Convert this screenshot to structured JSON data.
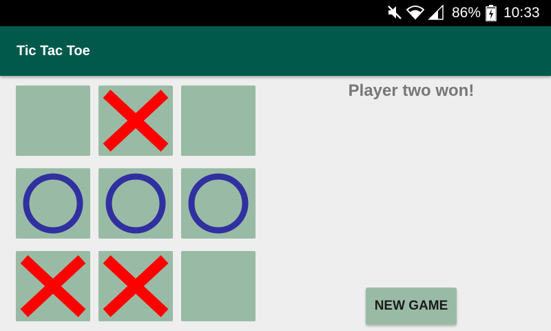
{
  "status_bar": {
    "battery_percent": "86%",
    "time": "10:33",
    "icons": [
      "mute-icon",
      "wifi-icon",
      "signal-icon",
      "battery-charging-icon"
    ]
  },
  "app_bar": {
    "title": "Tic Tac Toe",
    "color": "#00594b"
  },
  "board": {
    "cell_color": "#99bba5",
    "x_color": "#ff0000",
    "o_color": "#3030a0",
    "cells": [
      [
        "",
        "X",
        ""
      ],
      [
        "O",
        "O",
        "O"
      ],
      [
        "X",
        "X",
        ""
      ]
    ]
  },
  "game": {
    "status": "Player two won!",
    "new_game_label": "NEW GAME"
  }
}
